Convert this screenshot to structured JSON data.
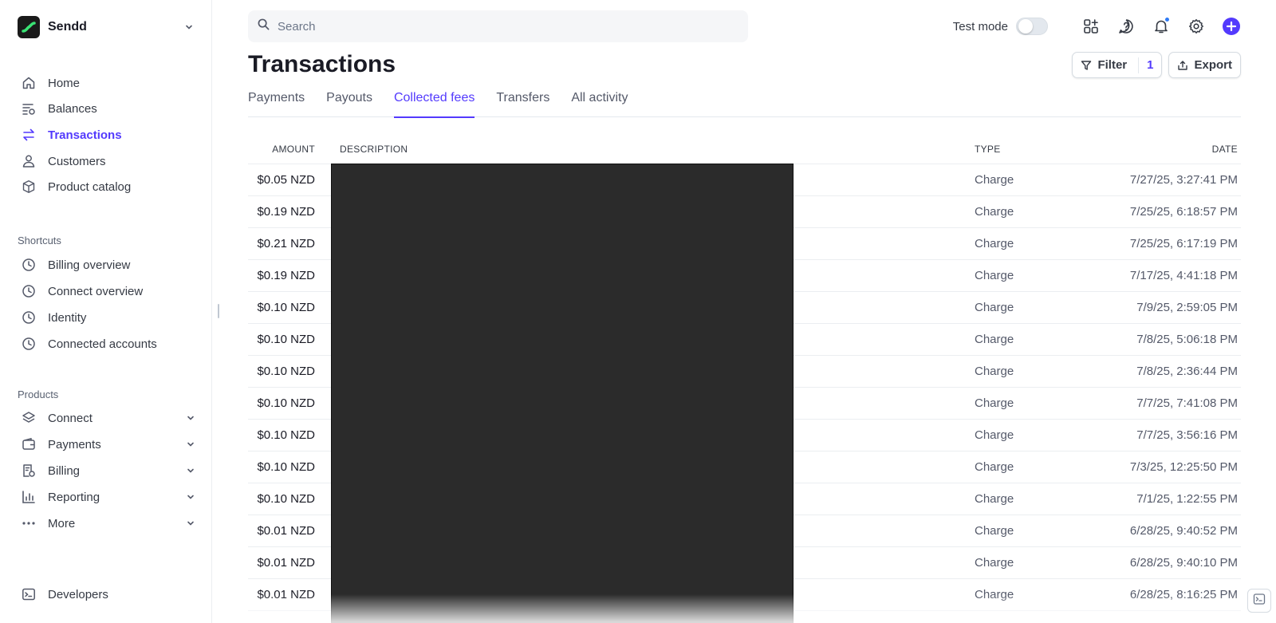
{
  "brand": {
    "name": "Sendd",
    "logo_icon": "sendd-logo-icon"
  },
  "sidebar": {
    "main_items": [
      {
        "label": "Home",
        "icon": "home-icon"
      },
      {
        "label": "Balances",
        "icon": "balances-icon"
      },
      {
        "label": "Transactions",
        "icon": "arrows-swap-icon",
        "active": true
      },
      {
        "label": "Customers",
        "icon": "person-icon"
      },
      {
        "label": "Product catalog",
        "icon": "box-icon"
      }
    ],
    "shortcuts_title": "Shortcuts",
    "shortcuts": [
      {
        "label": "Billing overview",
        "icon": "clock-icon"
      },
      {
        "label": "Connect overview",
        "icon": "clock-icon"
      },
      {
        "label": "Identity",
        "icon": "clock-icon"
      },
      {
        "label": "Connected accounts",
        "icon": "clock-icon"
      }
    ],
    "products_title": "Products",
    "products": [
      {
        "label": "Connect",
        "icon": "layers-icon"
      },
      {
        "label": "Payments",
        "icon": "wallet-icon"
      },
      {
        "label": "Billing",
        "icon": "receipt-icon"
      },
      {
        "label": "Reporting",
        "icon": "bar-chart-icon"
      },
      {
        "label": "More",
        "icon": "more-dots-icon"
      }
    ],
    "developers": {
      "label": "Developers",
      "icon": "terminal-icon"
    }
  },
  "search": {
    "placeholder": "Search",
    "value": ""
  },
  "topbar": {
    "test_mode_label": "Test mode",
    "test_mode_on": false
  },
  "page": {
    "title": "Transactions"
  },
  "actions": {
    "filter_label": "Filter",
    "filter_count": "1",
    "export_label": "Export"
  },
  "tabs": [
    {
      "label": "Payments",
      "active": false
    },
    {
      "label": "Payouts",
      "active": false
    },
    {
      "label": "Collected fees",
      "active": true
    },
    {
      "label": "Transfers",
      "active": false
    },
    {
      "label": "All activity",
      "active": false
    }
  ],
  "table": {
    "headers": {
      "amount": "AMOUNT",
      "description": "DESCRIPTION",
      "type": "TYPE",
      "date": "DATE"
    },
    "rows": [
      {
        "amount": "$0.05 NZD",
        "type": "Charge",
        "date": "7/27/25, 3:27:41 PM"
      },
      {
        "amount": "$0.19 NZD",
        "type": "Charge",
        "date": "7/25/25, 6:18:57 PM"
      },
      {
        "amount": "$0.21 NZD",
        "type": "Charge",
        "date": "7/25/25, 6:17:19 PM"
      },
      {
        "amount": "$0.19 NZD",
        "type": "Charge",
        "date": "7/17/25, 4:41:18 PM"
      },
      {
        "amount": "$0.10 NZD",
        "type": "Charge",
        "date": "7/9/25, 2:59:05 PM"
      },
      {
        "amount": "$0.10 NZD",
        "type": "Charge",
        "date": "7/8/25, 5:06:18 PM"
      },
      {
        "amount": "$0.10 NZD",
        "type": "Charge",
        "date": "7/8/25, 2:36:44 PM"
      },
      {
        "amount": "$0.10 NZD",
        "type": "Charge",
        "date": "7/7/25, 7:41:08 PM"
      },
      {
        "amount": "$0.10 NZD",
        "type": "Charge",
        "date": "7/7/25, 3:56:16 PM"
      },
      {
        "amount": "$0.10 NZD",
        "type": "Charge",
        "date": "7/3/25, 12:25:50 PM"
      },
      {
        "amount": "$0.10 NZD",
        "type": "Charge",
        "date": "7/1/25, 1:22:55 PM"
      },
      {
        "amount": "$0.01 NZD",
        "type": "Charge",
        "date": "6/28/25, 9:40:52 PM"
      },
      {
        "amount": "$0.01 NZD",
        "type": "Charge",
        "date": "6/28/25, 9:40:10 PM"
      },
      {
        "amount": "$0.01 NZD",
        "type": "Charge",
        "date": "6/28/25, 8:16:25 PM"
      }
    ]
  },
  "colors": {
    "accent": "#533afd",
    "text": "#353a44",
    "redaction": "#2b2b2b"
  }
}
